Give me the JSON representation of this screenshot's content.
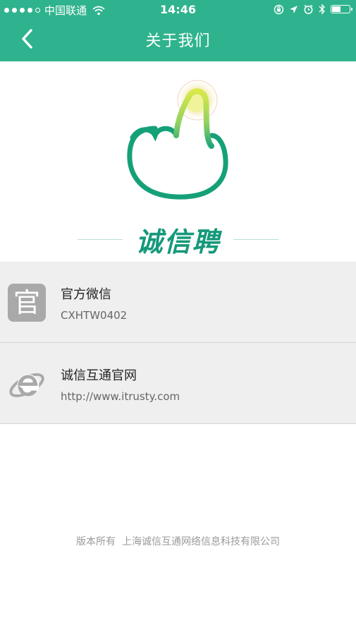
{
  "status_bar": {
    "carrier": "中国联通",
    "time": "14:46"
  },
  "navbar": {
    "title": "关于我们",
    "back_icon": "chevron-left-icon"
  },
  "brand": {
    "name": "诚信聘",
    "logo_icon": "pointing-hand-logo-icon",
    "color": "#15997a"
  },
  "contacts": [
    {
      "title": "官方微信",
      "subtitle": "CXHTW0402",
      "icon": "official-badge-icon",
      "icon_glyph": "官"
    },
    {
      "title": "诚信互通官网",
      "subtitle": "http://www.itrusty.com",
      "icon": "internet-explorer-icon"
    }
  ],
  "footer": {
    "copyright": "版本所有  上海诚信互通网络信息科技有限公司"
  },
  "colors": {
    "header": "#2fb38e",
    "list_bg": "#efefef",
    "icon_gray": "#a9a9a9"
  }
}
